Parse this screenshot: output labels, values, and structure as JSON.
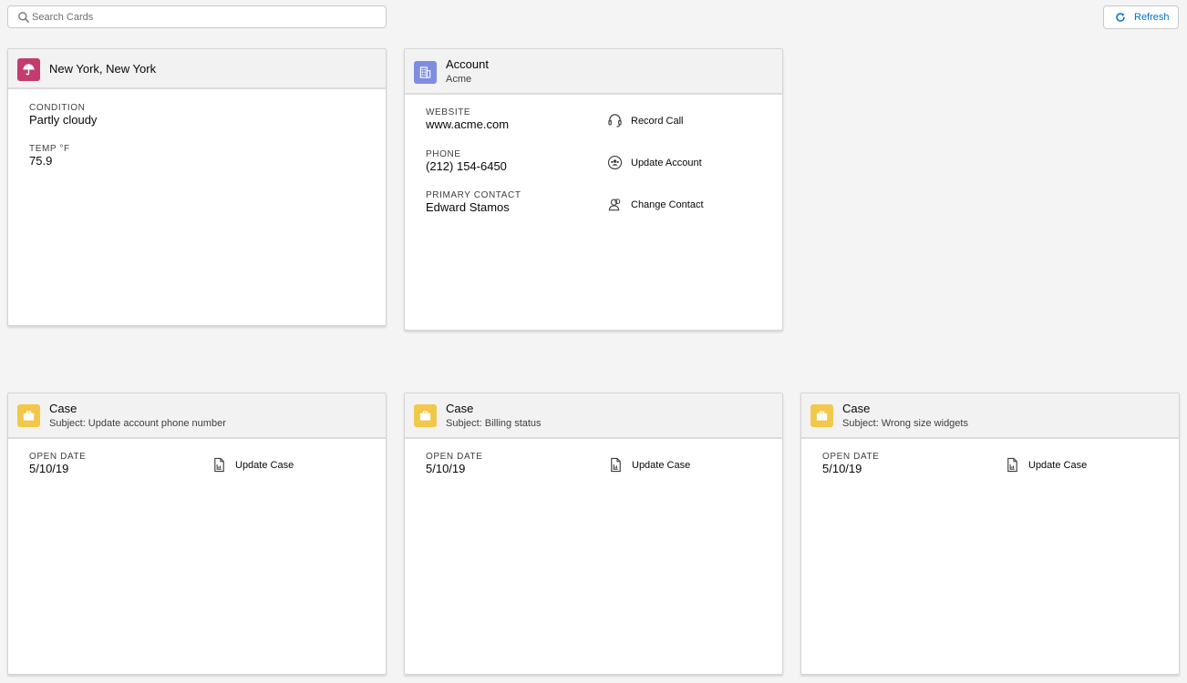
{
  "toolbar": {
    "search_placeholder": "Search Cards",
    "refresh_label": "Refresh"
  },
  "colors": {
    "weather_badge": "#c23c6e",
    "account_badge": "#7f8de1",
    "case_badge": "#f2c84b",
    "link": "#0070d2"
  },
  "weather": {
    "icon": "umbrella-icon",
    "title": "New York, New York",
    "condition_label": "CONDITION",
    "condition_value": "Partly cloudy",
    "temp_label": "TEMP °F",
    "temp_value": "75.9"
  },
  "account": {
    "icon": "building-icon",
    "title": "Account",
    "subtitle": "Acme",
    "fields": [
      {
        "label": "WEBSITE",
        "value": "www.acme.com"
      },
      {
        "label": "PHONE",
        "value": "(212) 154-6450"
      },
      {
        "label": "PRIMARY CONTACT",
        "value": "Edward Stamos"
      }
    ],
    "actions": [
      {
        "label": "Record Call",
        "icon": "headset-icon"
      },
      {
        "label": "Update Account",
        "icon": "people-icon"
      },
      {
        "label": "Change Contact",
        "icon": "user-contact-icon"
      }
    ]
  },
  "cases": [
    {
      "title": "Case",
      "subtitle": "Subject: Update account phone number",
      "field_label": "OPEN DATE",
      "field_value": "5/10/19",
      "action_label": "Update Case",
      "icon": "briefcase-icon",
      "action_icon": "document-chart-icon"
    },
    {
      "title": "Case",
      "subtitle": "Subject: Billing status",
      "field_label": "OPEN DATE",
      "field_value": "5/10/19",
      "action_label": "Update Case",
      "icon": "briefcase-icon",
      "action_icon": "document-chart-icon"
    },
    {
      "title": "Case",
      "subtitle": "Subject: Wrong size widgets",
      "field_label": "OPEN DATE",
      "field_value": "5/10/19",
      "action_label": "Update Case",
      "icon": "briefcase-icon",
      "action_icon": "document-chart-icon"
    }
  ]
}
